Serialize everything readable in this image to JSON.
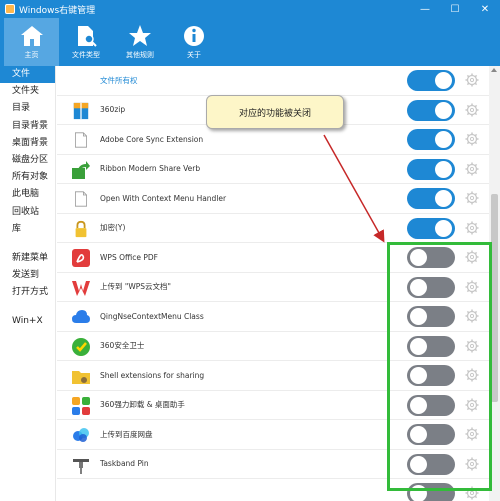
{
  "window": {
    "title": "Windows右键管理",
    "controls": [
      "—",
      "☐",
      "✕"
    ]
  },
  "toolbar": {
    "items": [
      {
        "label": "主页",
        "icon": "home-icon",
        "active": true
      },
      {
        "label": "文件类型",
        "icon": "file-search-icon",
        "active": false
      },
      {
        "label": "其他规则",
        "icon": "star-icon",
        "active": false
      },
      {
        "label": "关于",
        "icon": "info-icon",
        "active": false
      }
    ]
  },
  "sidebar": {
    "items": [
      {
        "label": "文件",
        "active": true
      },
      {
        "label": "文件夹"
      },
      {
        "label": "目录"
      },
      {
        "label": "目录背景"
      },
      {
        "label": "桌面背景"
      },
      {
        "label": "磁盘分区"
      },
      {
        "label": "所有对象"
      },
      {
        "label": "此电脑"
      },
      {
        "label": "回收站"
      },
      {
        "label": "库"
      }
    ],
    "items2": [
      {
        "label": "新建菜单"
      },
      {
        "label": "发送到"
      },
      {
        "label": "打开方式"
      }
    ],
    "items3": [
      {
        "label": "Win+X"
      }
    ]
  },
  "menu_items": [
    {
      "name": "文件所有权",
      "on": true,
      "icon": "none"
    },
    {
      "name": "360zip",
      "on": true,
      "icon": "360zip-icon"
    },
    {
      "name": "Adobe Core Sync Extension",
      "on": true,
      "icon": "document-icon"
    },
    {
      "name": "Ribbon Modern Share Verb",
      "on": true,
      "icon": "share-arrow-icon"
    },
    {
      "name": "Open With Context Menu Handler",
      "on": true,
      "icon": "document-icon"
    },
    {
      "name": "加密(Y)",
      "on": true,
      "icon": "lock-icon"
    },
    {
      "name": "WPS Office PDF",
      "on": false,
      "icon": "wps-pdf-icon"
    },
    {
      "name": "上传到 \"WPS云文档\"",
      "on": false,
      "icon": "wps-cloud-icon"
    },
    {
      "name": "QingNseContextMenu Class",
      "on": false,
      "icon": "cloud-icon"
    },
    {
      "name": "360安全卫士",
      "on": false,
      "icon": "360-safe-icon"
    },
    {
      "name": "Shell extensions for sharing",
      "on": false,
      "icon": "share-folder-icon"
    },
    {
      "name": "360强力卸载 & 桌面助手",
      "on": false,
      "icon": "360-uninstall-icon"
    },
    {
      "name": "上传到百度网盘",
      "on": false,
      "icon": "baidu-netdisk-icon"
    },
    {
      "name": "Taskband Pin",
      "on": false,
      "icon": "pin-icon"
    },
    {
      "name": "",
      "on": false,
      "icon": "none"
    }
  ],
  "annotation": {
    "callout_text": "对应的功能被关闭",
    "highlight_color": "#33bb3a",
    "arrow_color": "#c62828"
  },
  "colors": {
    "accent": "#1e88d4",
    "toggle_on": "#1e88d4",
    "toggle_off": "#7b7f86"
  }
}
